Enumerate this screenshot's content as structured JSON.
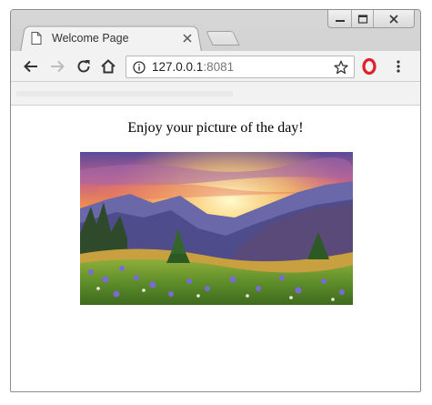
{
  "browser": {
    "tab_title": "Welcome Page",
    "url_host": "127.0.0.1",
    "url_port": ":8081"
  },
  "page": {
    "heading": "Enjoy your picture of the day!"
  },
  "icons": {
    "tab": "document-icon",
    "tab_close": "close-icon",
    "back": "back-arrow-icon",
    "forward": "forward-arrow-icon",
    "reload": "reload-icon",
    "home": "home-icon",
    "site_info": "info-icon",
    "bookmark": "star-icon",
    "extension": "opera-icon",
    "menu": "kebab-menu-icon"
  },
  "colors": {
    "extension_red": "#e0212b"
  }
}
